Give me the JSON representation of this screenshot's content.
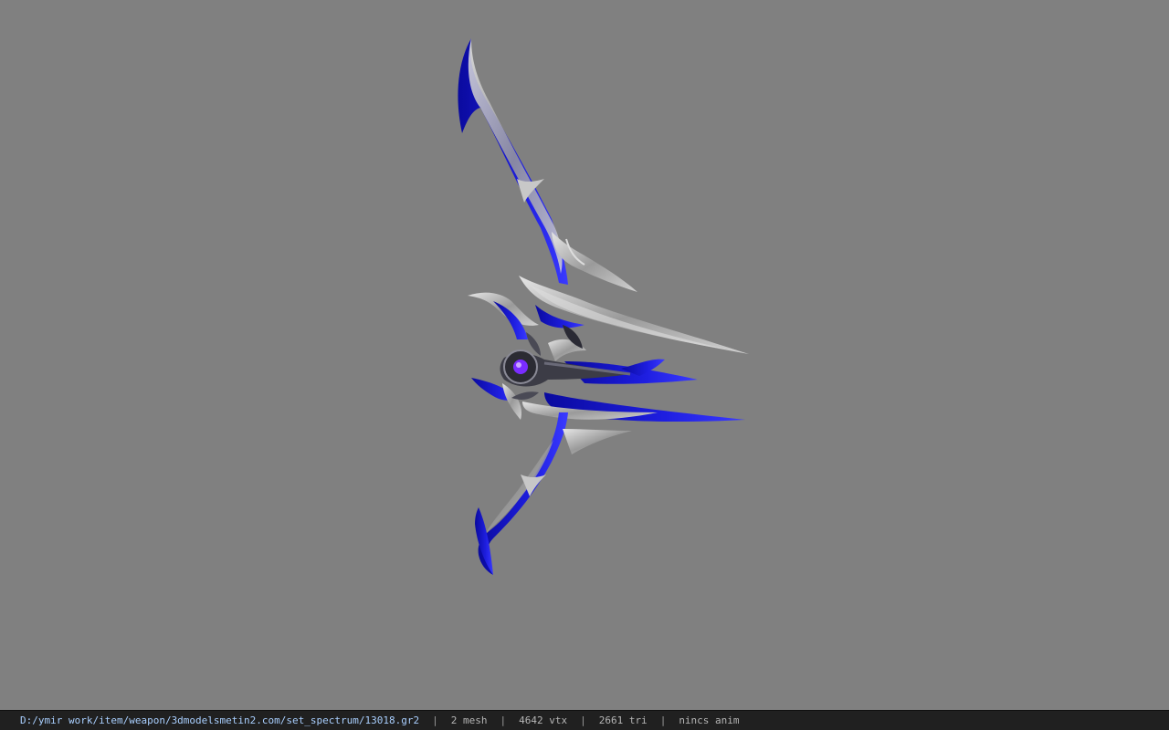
{
  "viewport": {
    "background_color": "#808080",
    "model_colors": {
      "blade_blue": "#1414c8",
      "blade_silver": "#b4b4b4",
      "hilt_dark": "#3c3c46",
      "gem": "#7a2cff"
    }
  },
  "status_bar": {
    "path": "D:/ymir work/item/weapon/3dmodelsmetin2.com/set_spectrum/13018.gr2",
    "separator": "|",
    "mesh": "2 mesh",
    "vertices": "4642 vtx",
    "triangles": "2661 tri",
    "anim": "nincs anim",
    "path_color": "#a9cfff",
    "text_color": "#b5b5b5",
    "background_color": "#202020"
  }
}
